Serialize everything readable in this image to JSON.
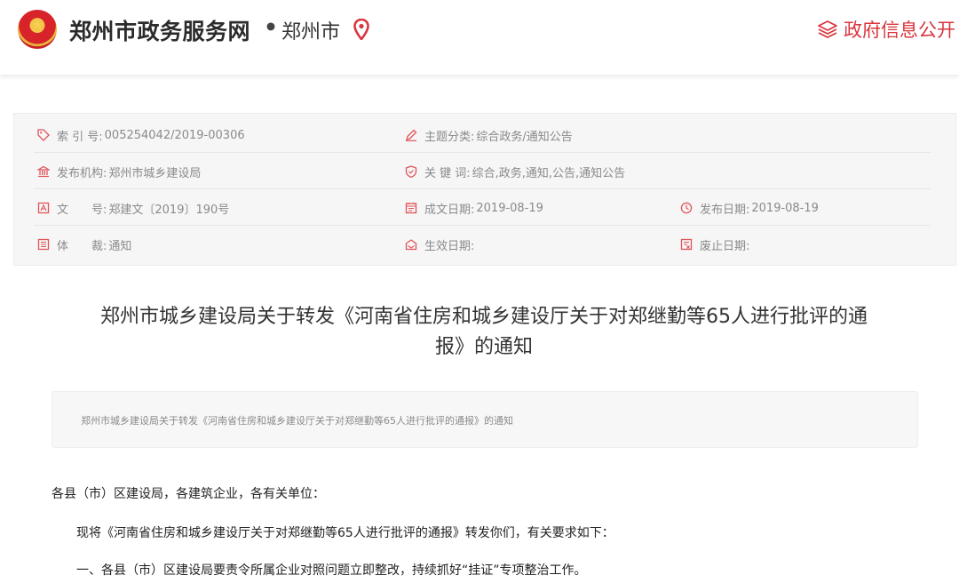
{
  "header": {
    "site_title": "郑州市政务服务网",
    "separator": "•",
    "city": "郑州市",
    "gov_info_link": "政府信息公开"
  },
  "info": {
    "index_no": {
      "label": "索 引 号:",
      "value": "005254042/2019-00306"
    },
    "subject": {
      "label": "主题分类:",
      "value": "综合政务/通知公告"
    },
    "publisher": {
      "label": "发布机构:",
      "value": "郑州市城乡建设局"
    },
    "keywords": {
      "label": "关 键 词:",
      "value": "综合,政务,通知,公告,通知公告"
    },
    "doc_no": {
      "label": "文　　号:",
      "value": "郑建文〔2019〕190号"
    },
    "created_date": {
      "label": "成文日期:",
      "value": "2019-08-19"
    },
    "publish_date": {
      "label": "发布日期:",
      "value": "2019-08-19"
    },
    "genre": {
      "label": "体　　裁:",
      "value": "通知"
    },
    "effective_date": {
      "label": "生效日期:",
      "value": ""
    },
    "expiry_date": {
      "label": "废止日期:",
      "value": ""
    }
  },
  "article": {
    "title_line1": "郑州市城乡建设局关于转发《河南省住房和城乡建设厅关于对郑继勤等65人进行批评的通",
    "title_line2": "报》的通知",
    "summary": "郑州市城乡建设局关于转发《河南省住房和城乡建设厅关于对郑继勤等65人进行批评的通报》的通知",
    "salutation": "各县（市）区建设局，各建筑企业，各有关单位：",
    "para1": "现将《河南省住房和城乡建设厅关于对郑继勤等65人进行批评的通报》转发你们，有关要求如下：",
    "para2": "一、各县（市）区建设局要责令所属企业对照问题立即整改，持续抓好“挂证”专项整治工作。"
  },
  "colors": {
    "accent_red": "#d9363e",
    "icon_red": "#e0555b",
    "panel_bg": "#f6f6f6"
  },
  "icons": {
    "location": "map-pin-icon",
    "gov_info": "layers-icon",
    "index_no": "tag-icon",
    "subject": "pencil-icon",
    "publisher": "building-icon",
    "keywords": "shield-icon",
    "doc_no": "document-icon",
    "created_date": "calendar-icon",
    "publish_date": "clock-icon",
    "genre": "list-icon",
    "effective_date": "stamp-icon",
    "expiry_date": "invalid-icon"
  }
}
